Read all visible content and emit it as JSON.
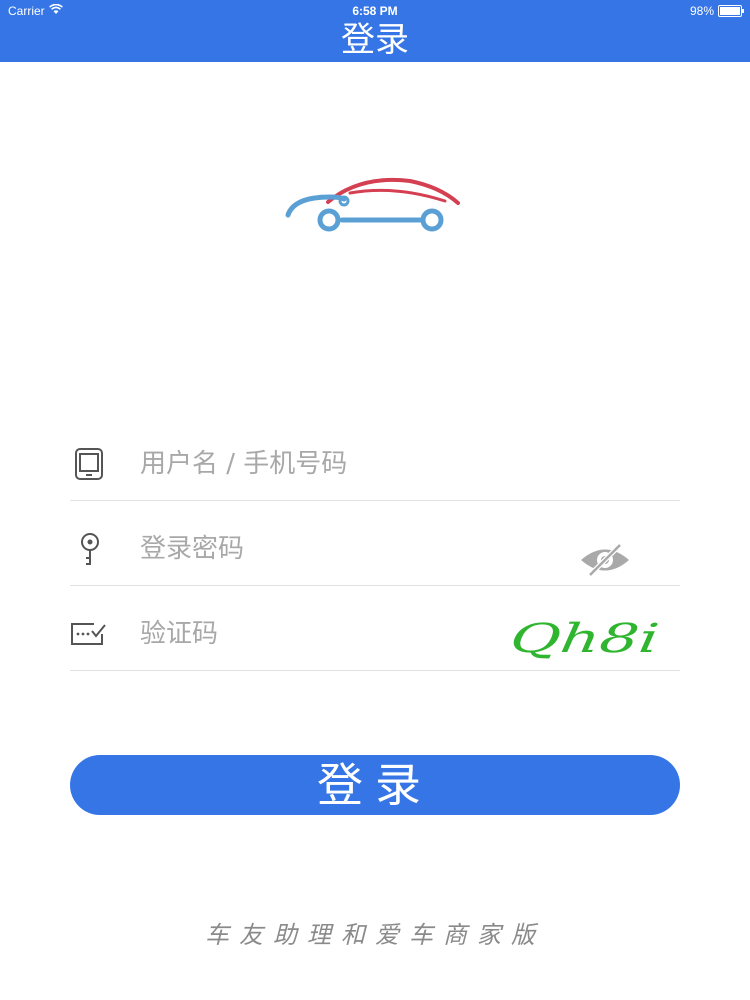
{
  "status_bar": {
    "carrier": "Carrier",
    "time": "6:58 PM",
    "battery": "98%",
    "battery_level": 0.98
  },
  "nav": {
    "title": "登录"
  },
  "form": {
    "username": {
      "placeholder": "用户名 / 手机号码",
      "value": "",
      "icon": "phone-icon"
    },
    "password": {
      "placeholder": "登录密码",
      "value": "",
      "icon": "key-icon",
      "toggle_icon": "eye-hidden-icon"
    },
    "captcha": {
      "placeholder": "验证码",
      "value": "",
      "icon": "verify-icon",
      "image_text": "Qh8i"
    }
  },
  "login_button": {
    "label": "登录"
  },
  "footer": {
    "text": "车友助理和爱车商家版"
  },
  "colors": {
    "primary": "#3575e6",
    "logo_blue": "#5aa0d4",
    "logo_red": "#d44052",
    "captcha_green": "#2fb52f",
    "placeholder": "#a8a8a8",
    "divider": "#e2e2e2"
  }
}
